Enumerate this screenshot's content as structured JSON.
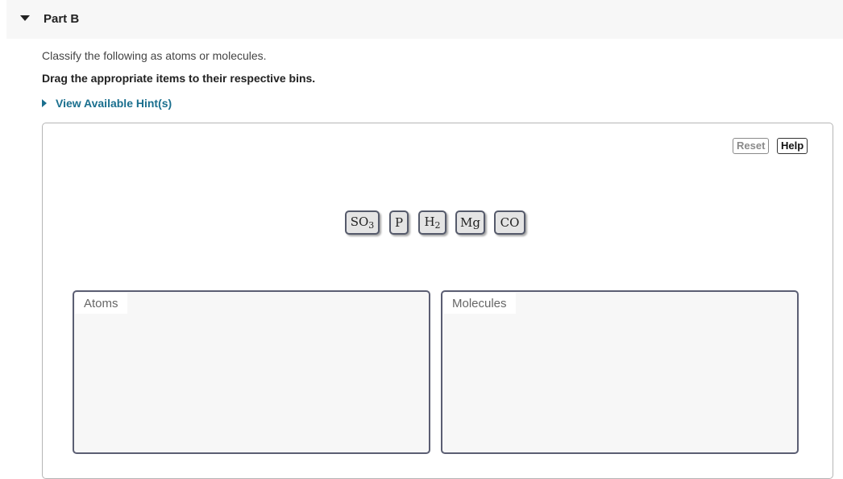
{
  "header": {
    "title": "Part B",
    "toggle_icon": "caret-down-icon"
  },
  "instructions": {
    "text": "Classify the following as atoms or molecules.",
    "bold_text": "Drag the appropriate items to their respective bins."
  },
  "hint": {
    "label": "View Available Hint(s)",
    "icon": "caret-right-icon",
    "color": "#1a6f8e"
  },
  "toolbar": {
    "reset_label": "Reset",
    "help_label": "Help"
  },
  "tiles": [
    {
      "base": "SO",
      "sub": "3"
    },
    {
      "base": "P",
      "sub": ""
    },
    {
      "base": "H",
      "sub": "2"
    },
    {
      "base": "Mg",
      "sub": ""
    },
    {
      "base": "CO",
      "sub": ""
    }
  ],
  "bins": [
    {
      "label": "Atoms",
      "items": []
    },
    {
      "label": "Molecules",
      "items": []
    }
  ]
}
